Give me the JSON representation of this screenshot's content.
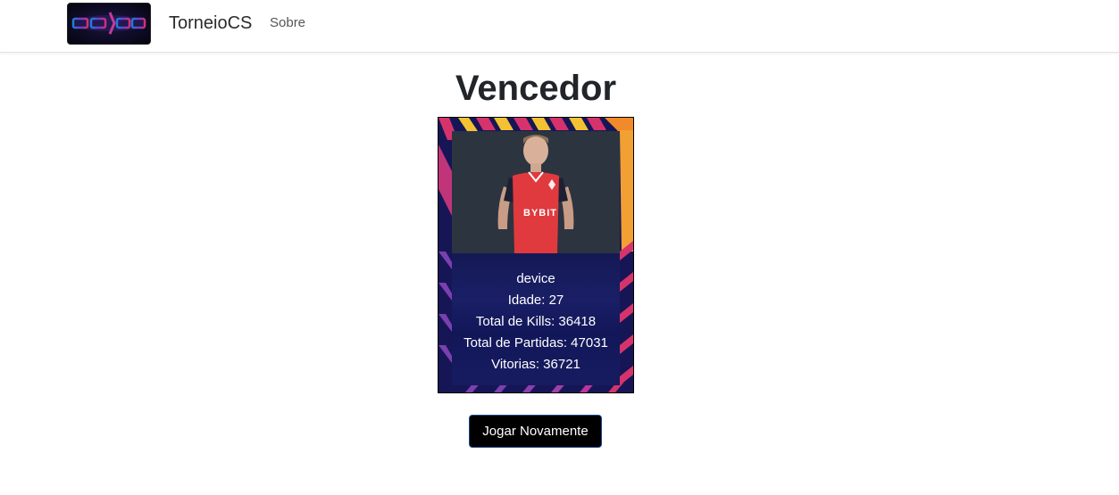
{
  "navbar": {
    "logo_text": "CS:GO",
    "brand": "TorneioCS",
    "links": [
      {
        "label": "Sobre"
      }
    ]
  },
  "main": {
    "title": "Vencedor",
    "winner": {
      "name": "device",
      "age_line": "Idade: 27",
      "kills_line": "Total de Kills: 36418",
      "matches_line": "Total de Partidas: 47031",
      "wins_line": "Vitorias: 36721",
      "jersey_text": "BYBIT"
    },
    "play_again_label": "Jogar Novamente"
  },
  "colors": {
    "card_bg": "#161656",
    "stripe_pink": "#d6336c",
    "stripe_yellow": "#f2c233",
    "stripe_orange": "#f08a2a",
    "stripe_purple": "#7b3fb0",
    "jersey_red": "#e03a3e",
    "button_bg": "#000000"
  }
}
